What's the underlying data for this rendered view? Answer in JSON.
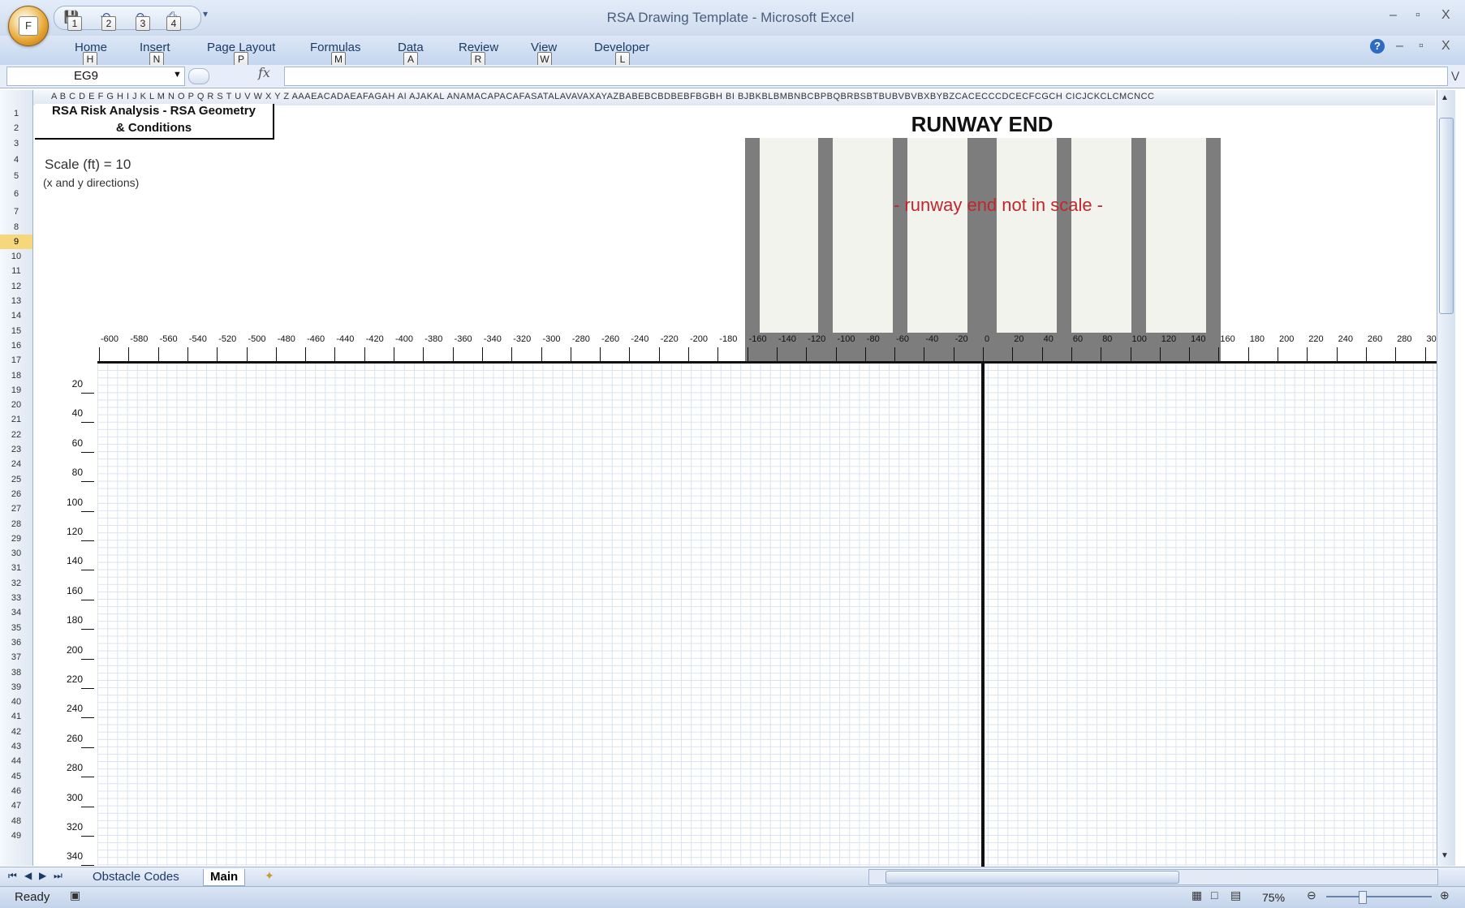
{
  "window": {
    "title": "RSA Drawing Template - Microsoft Excel",
    "office_button_keytip": "F",
    "qat_keytips": [
      "1",
      "2",
      "3",
      "4"
    ],
    "qat_customize": "▾",
    "controls": {
      "minimize": "–",
      "restore": "▫",
      "close": "X"
    }
  },
  "ribbon": {
    "tabs": [
      {
        "label": "Home",
        "keytip": "H"
      },
      {
        "label": "Insert",
        "keytip": "N"
      },
      {
        "label": "Page Layout",
        "keytip": "P"
      },
      {
        "label": "Formulas",
        "keytip": "M"
      },
      {
        "label": "Data",
        "keytip": "A"
      },
      {
        "label": "Review",
        "keytip": "R"
      },
      {
        "label": "View",
        "keytip": "W"
      },
      {
        "label": "Developer",
        "keytip": "L"
      }
    ],
    "help": "?",
    "wb_controls": {
      "minimize": "–",
      "restore": "▫",
      "close": "X"
    }
  },
  "formula_bar": {
    "name_box": "EG9",
    "fx": "fx",
    "formula": ""
  },
  "columns_text": "A  B C D E F G H I  J  K L M N O P Q R S T U V W X Y Z AAAEACADAEAFAGAH AI AJAKAL ANAMACAPACAFASATALAVAVAXAYAZBABEBCBDBEBFBGBH BI BJBKBLBMBNBCBPBQBRBSBTBUBVBVBXBYBZCACECCCDCECFCGCH CICJCKCLCMCNCC",
  "rows": [
    "1",
    "2",
    "3",
    "4",
    "5",
    "6",
    "7",
    "8",
    "9",
    "10",
    "11",
    "12",
    "13",
    "14",
    "15",
    "16",
    "17",
    "18",
    "19",
    "20",
    "21",
    "22",
    "23",
    "24",
    "25",
    "26",
    "27",
    "28",
    "29",
    "30",
    "31",
    "32",
    "33",
    "34",
    "35",
    "36",
    "37",
    "38",
    "39",
    "40",
    "41",
    "42",
    "43",
    "44",
    "45",
    "46",
    "47",
    "48",
    "49"
  ],
  "selected_row": "9",
  "drawing": {
    "title_line1": "RSA Risk Analysis - RSA Geometry",
    "title_line2": "& Conditions",
    "scale_label": "Scale (ft) =    10",
    "scale_sub": "(x and y directions)",
    "runway_title": "RUNWAY END",
    "runway_note": "- runway end not in scale -",
    "x_ticks": [
      "-600",
      "-580",
      "-560",
      "-540",
      "-520",
      "-500",
      "-480",
      "-460",
      "-440",
      "-420",
      "-400",
      "-380",
      "-360",
      "-340",
      "-320",
      "-300",
      "-280",
      "-260",
      "-240",
      "-220",
      "-200",
      "-180",
      "-160",
      "-140",
      "-120",
      "-100",
      "-80",
      "-60",
      "-40",
      "-20",
      "0",
      "20",
      "40",
      "60",
      "80",
      "100",
      "120",
      "140",
      "160",
      "180",
      "200",
      "220",
      "240",
      "260",
      "280",
      "30"
    ],
    "y_ticks": [
      "20",
      "40",
      "60",
      "80",
      "100",
      "120",
      "140",
      "160",
      "180",
      "200",
      "220",
      "240",
      "260",
      "280",
      "300",
      "320",
      "340"
    ]
  },
  "sheet_tabs": [
    {
      "label": "Obstacle Codes",
      "active": false
    },
    {
      "label": "Main",
      "active": true
    }
  ],
  "status": {
    "ready": "Ready",
    "zoom": "75%"
  },
  "colors": {
    "runway": "#7d7d7d",
    "stripe": "#f2f3ec",
    "note": "#c0272d",
    "grid": "#d9e3f1"
  }
}
